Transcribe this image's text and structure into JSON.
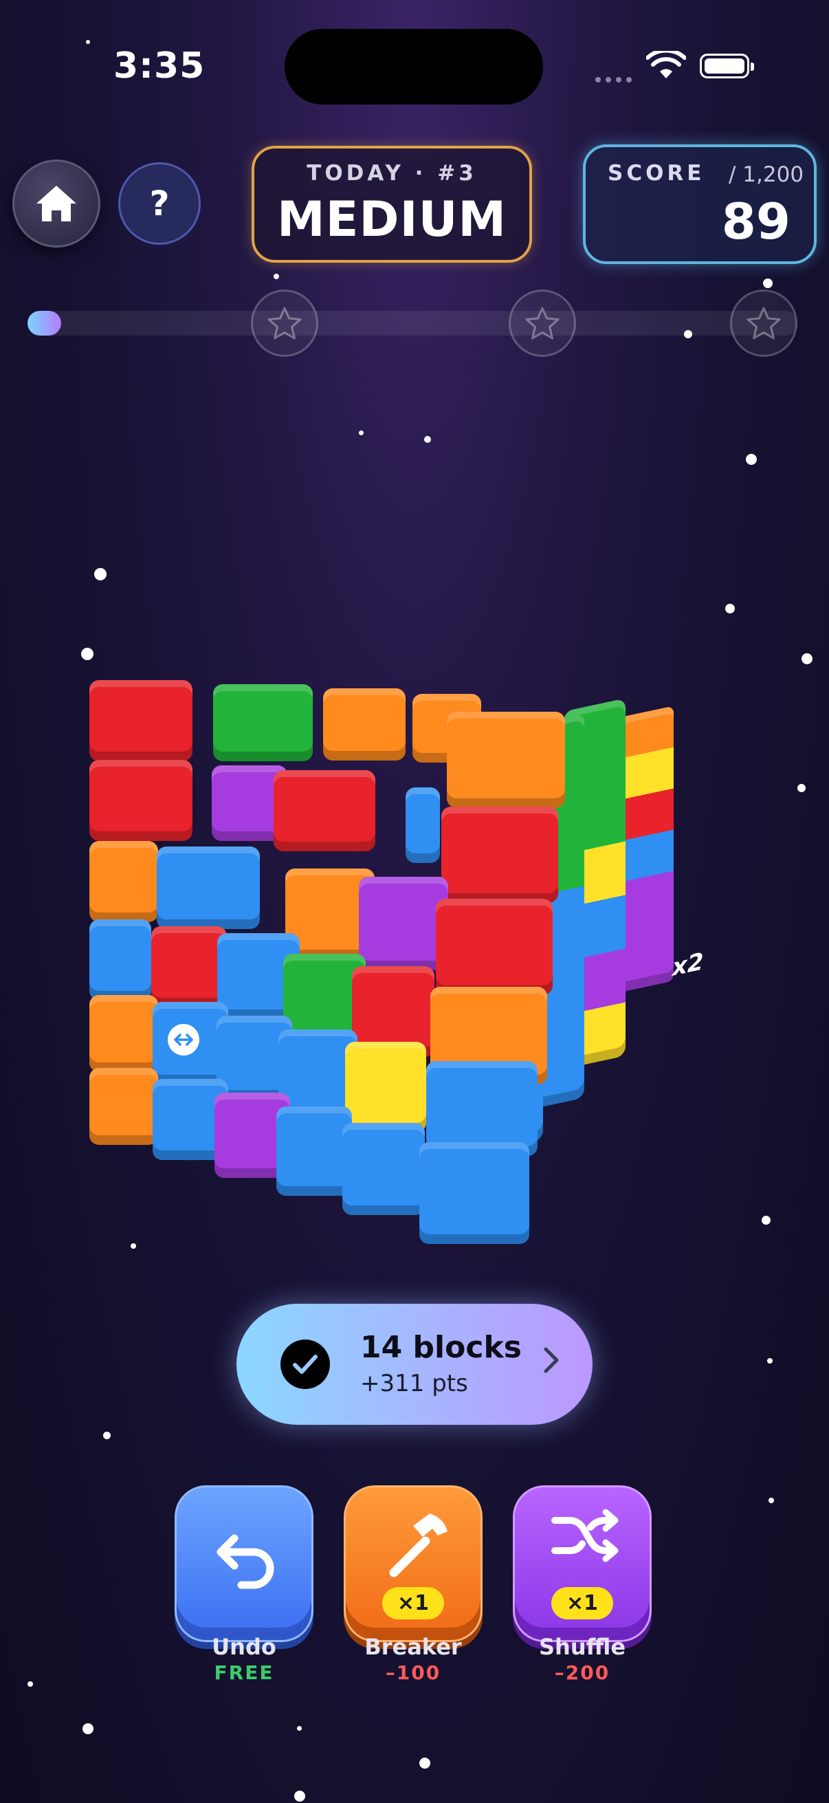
{
  "status": {
    "time": "3:35"
  },
  "header": {
    "today_label": "TODAY · #3",
    "today_value": "MEDIUM",
    "score_label": "SCORE",
    "score_target": "/ 1,200",
    "score_value": "89"
  },
  "progress": {
    "fraction": 0.044,
    "stars": 3
  },
  "help_label": "?",
  "combo": {
    "title": "14 blocks",
    "points": "+311 pts"
  },
  "cube_labels": {
    "bonus": "x2"
  },
  "powerups": [
    {
      "name": "Undo",
      "cost": "FREE",
      "cost_color": "#3ccc6a"
    },
    {
      "name": "Breaker",
      "cost": "–100",
      "cost_color": "#ff5a5a",
      "badge": "×1"
    },
    {
      "name": "Shuffle",
      "cost": "–200",
      "cost_color": "#ff5a5a",
      "badge": "×1"
    }
  ],
  "colors": {
    "red": "#e8232b",
    "green": "#22b43a",
    "orange": "#ff8a1e",
    "blue": "#2f8ff2",
    "purple": "#a63ce0",
    "yellow": "#ffe12a"
  }
}
